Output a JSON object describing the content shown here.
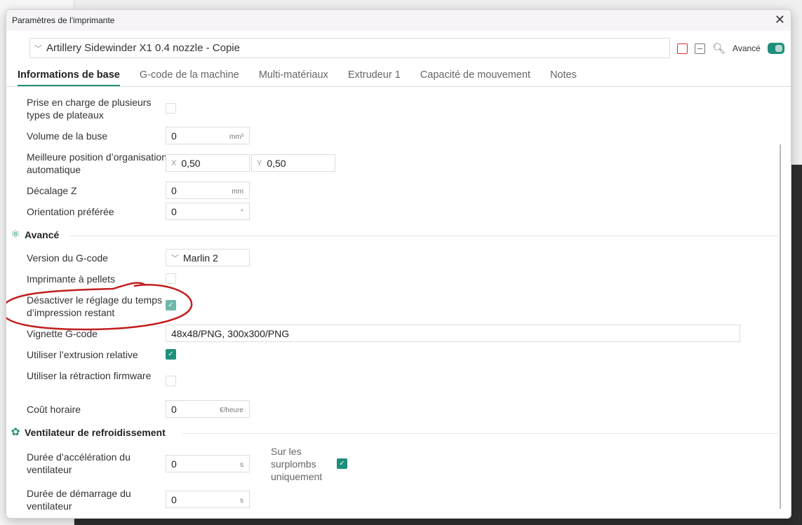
{
  "title": "Paramètres de l'imprimante",
  "preset": "Artillery Sidewinder X1 0.4 nozzle - Copie",
  "advanced_label": "Avancé",
  "tabs": [
    "Informations de base",
    "G-code de la machine",
    "Multi-matériaux",
    "Extrudeur 1",
    "Capacité de mouvement",
    "Notes"
  ],
  "basic": {
    "multi_plate": "Prise en charge de plusieurs types de plateaux",
    "nozzle_volume": {
      "label": "Volume de la buse",
      "value": "0",
      "unit": "mm³"
    },
    "best_pos": {
      "label": "Meilleure position d’organisation automatique",
      "x_label": "X",
      "x": "0,50",
      "y_label": "Y",
      "y": "0,50"
    },
    "z_offset": {
      "label": "Décalage Z",
      "value": "0",
      "unit": "mm"
    },
    "orientation": {
      "label": "Orientation préférée",
      "value": "0",
      "unit": "°"
    }
  },
  "advanced": {
    "title": "Avancé",
    "gcode_version": {
      "label": "Version du G-code",
      "value": "Marlin 2"
    },
    "pellet": {
      "label": "Imprimante à pellets",
      "checked": false
    },
    "disable_time": {
      "label": "Désactiver le réglage du temps d’impression restant",
      "checked": true
    },
    "thumbnail": {
      "label": "Vignette G-code",
      "value": "48x48/PNG, 300x300/PNG"
    },
    "relative_ext": {
      "label": "Utiliser l’extrusion relative",
      "checked": true
    },
    "fw_retract": {
      "label": "Utiliser la rétraction firmware",
      "checked": false
    },
    "hourly_cost": {
      "label": "Coût horaire",
      "value": "0",
      "unit": "€/heure"
    }
  },
  "fan": {
    "title": "Ventilateur de refroidissement",
    "accel": {
      "label": "Durée d’accélération du ventilateur",
      "value": "0",
      "unit": "s"
    },
    "overhang": {
      "label": "Sur les surplombs uniquement",
      "checked": true
    },
    "start": {
      "label": "Durée de démarrage du ventilateur",
      "value": "0",
      "unit": "s"
    }
  }
}
